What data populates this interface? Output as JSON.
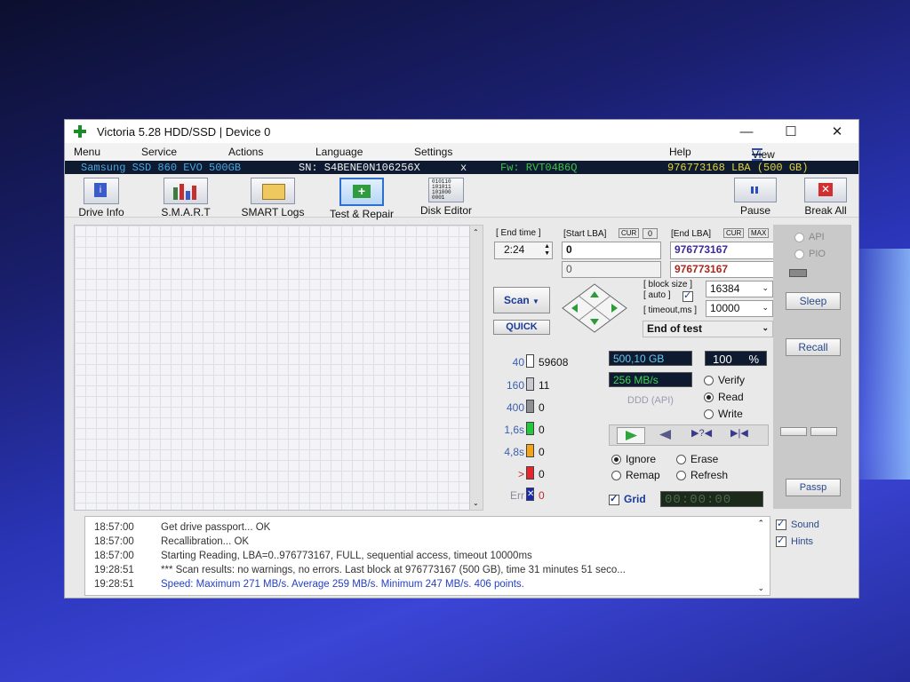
{
  "window": {
    "title": "Victoria 5.28 HDD/SSD | Device 0"
  },
  "menu": {
    "items": [
      "Menu",
      "Service",
      "Actions",
      "Language",
      "Settings",
      "Help"
    ],
    "view_buffer": "View Buffer Live"
  },
  "device": {
    "model": "Samsung SSD 860 EVO 500GB",
    "serial": "SN: S4BENE0N106256X",
    "close": "x",
    "firmware": "Fw: RVT04B6Q",
    "lba": "976773168 LBA (500 GB)"
  },
  "toolbar": {
    "drive_info": "Drive Info",
    "smart": "S.M.A.R.T",
    "smart_logs": "SMART Logs",
    "test_repair": "Test & Repair",
    "disk_editor": "Disk Editor",
    "pause": "Pause",
    "break_all": "Break All",
    "disk_editor_digits": "010110\n101011\n101000\n0001"
  },
  "scan": {
    "end_time_label": "[ End time ]",
    "end_time": "2:24",
    "start_lba_label": "[Start LBA]",
    "cur": "CUR",
    "start_cur_value": "0",
    "start_lba": "0",
    "start_lba2": "0",
    "end_lba_label": "[End LBA]",
    "max": "MAX",
    "end_lba": "976773167",
    "end_lba2": "976773167",
    "scan_button": "Scan",
    "quick": "QUICK",
    "block_size_label": "[ block size ]",
    "auto_label": "[ auto ]",
    "block_size": "16384",
    "timeout_label": "[ timeout,ms ]",
    "timeout": "10000",
    "end_action": "End of test"
  },
  "stats": {
    "rows": [
      {
        "label": "40",
        "count": "59608",
        "color": "#ffffff"
      },
      {
        "label": "160",
        "count": "11",
        "color": "#c9c9cf"
      },
      {
        "label": "400",
        "count": "0",
        "color": "#8f8f96"
      },
      {
        "label": "1,6s",
        "count": "0",
        "color": "#22c93a"
      },
      {
        "label": "4,8s",
        "count": "0",
        "color": "#f2a51a"
      },
      {
        "label": ">",
        "count": "0",
        "color": "#e8252b"
      },
      {
        "label": "Err",
        "count": "0",
        "color": "#1a2ab0"
      }
    ],
    "capacity": "500,10 GB",
    "percent": "100",
    "percent_sign": "%",
    "speed": "256 MB/s",
    "ddd_api": "DDD (API)",
    "mode_options": [
      "Verify",
      "Read",
      "Write"
    ],
    "mode_selected": "Read",
    "repair_options": [
      "Ignore",
      "Erase",
      "Remap",
      "Refresh"
    ],
    "repair_selected": "Ignore",
    "grid_label": "Grid",
    "timer": "00:00:00"
  },
  "rightpanel": {
    "api": "API",
    "pio": "PIO",
    "sleep": "Sleep",
    "recall": "Recall",
    "passp": "Passp"
  },
  "options": {
    "sound": "Sound",
    "hints": "Hints"
  },
  "log": [
    {
      "time": "18:57:00",
      "text": "Get drive passport... OK",
      "color": "#333333"
    },
    {
      "time": "18:57:00",
      "text": "Recallibration... OK",
      "color": "#333333"
    },
    {
      "time": "18:57:00",
      "text": "Starting Reading, LBA=0..976773167, FULL, sequential access, timeout 10000ms",
      "color": "#333333"
    },
    {
      "time": "19:28:51",
      "text": "*** Scan results: no warnings, no errors. Last block at 976773167 (500 GB), time 31 minutes 51 seco...",
      "color": "#333333"
    },
    {
      "time": "19:28:51",
      "text": "Speed: Maximum 271 MB/s. Average 259 MB/s. Minimum 247 MB/s. 406 points.",
      "color": "#2440c8"
    }
  ]
}
